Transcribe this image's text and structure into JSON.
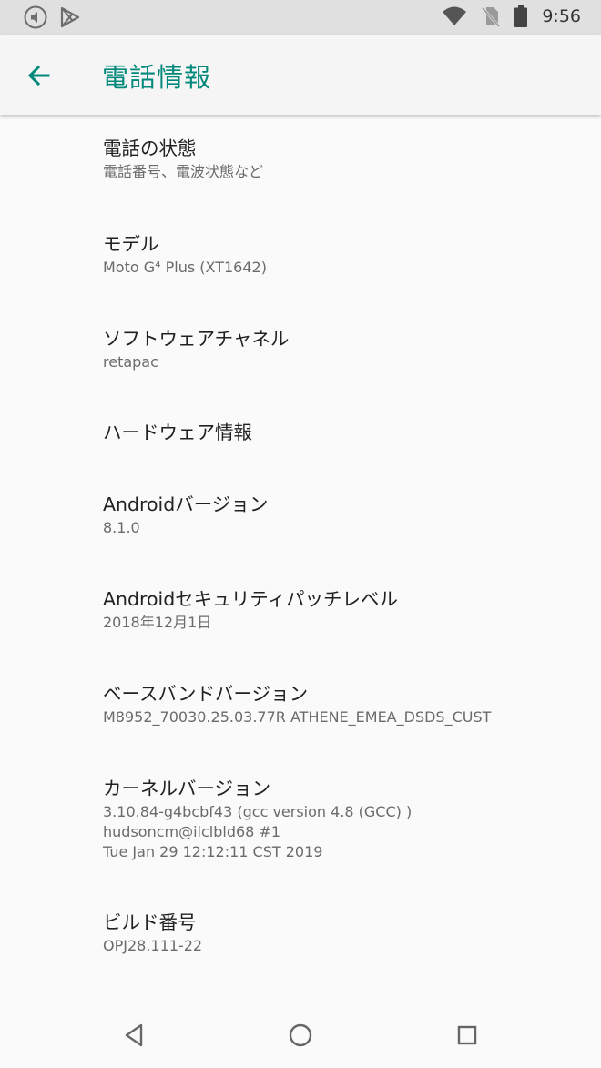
{
  "status_bar": {
    "time": "9:56",
    "left_icons": [
      "media-volume-icon",
      "play-store-icon"
    ],
    "right_icons": [
      "wifi-icon",
      "no-sim-icon",
      "battery-icon"
    ]
  },
  "app_bar": {
    "title": "電話情報"
  },
  "items": [
    {
      "title": "電話の状態",
      "lines": [
        "電話番号、電波状態など"
      ]
    },
    {
      "title": "モデル",
      "lines": [
        "Moto G⁴ Plus (XT1642)"
      ]
    },
    {
      "title": "ソフトウェアチャネル",
      "lines": [
        "retapac"
      ]
    },
    {
      "title": "ハードウェア情報",
      "lines": []
    },
    {
      "title": "Androidバージョン",
      "lines": [
        "8.1.0"
      ]
    },
    {
      "title": "Androidセキュリティパッチレベル",
      "lines": [
        "2018年12月1日"
      ]
    },
    {
      "title": "ベースバンドバージョン",
      "lines": [
        "M8952_70030.25.03.77R ATHENE_EMEA_DSDS_CUST"
      ]
    },
    {
      "title": "カーネルバージョン",
      "lines": [
        "3.10.84-g4bcbf43 (gcc version 4.8 (GCC) )",
        "hudsoncm@ilclbld68 #1",
        "Tue Jan 29 12:12:11 CST 2019"
      ]
    },
    {
      "title": "ビルド番号",
      "lines": [
        "OPJ28.111-22"
      ]
    }
  ],
  "nav_bar": {
    "buttons": [
      "back-nav-icon",
      "home-nav-icon",
      "recents-nav-icon"
    ]
  },
  "colors": {
    "accent": "#00897b",
    "status_bar": "#e0e0e0",
    "background": "#fafafa"
  }
}
